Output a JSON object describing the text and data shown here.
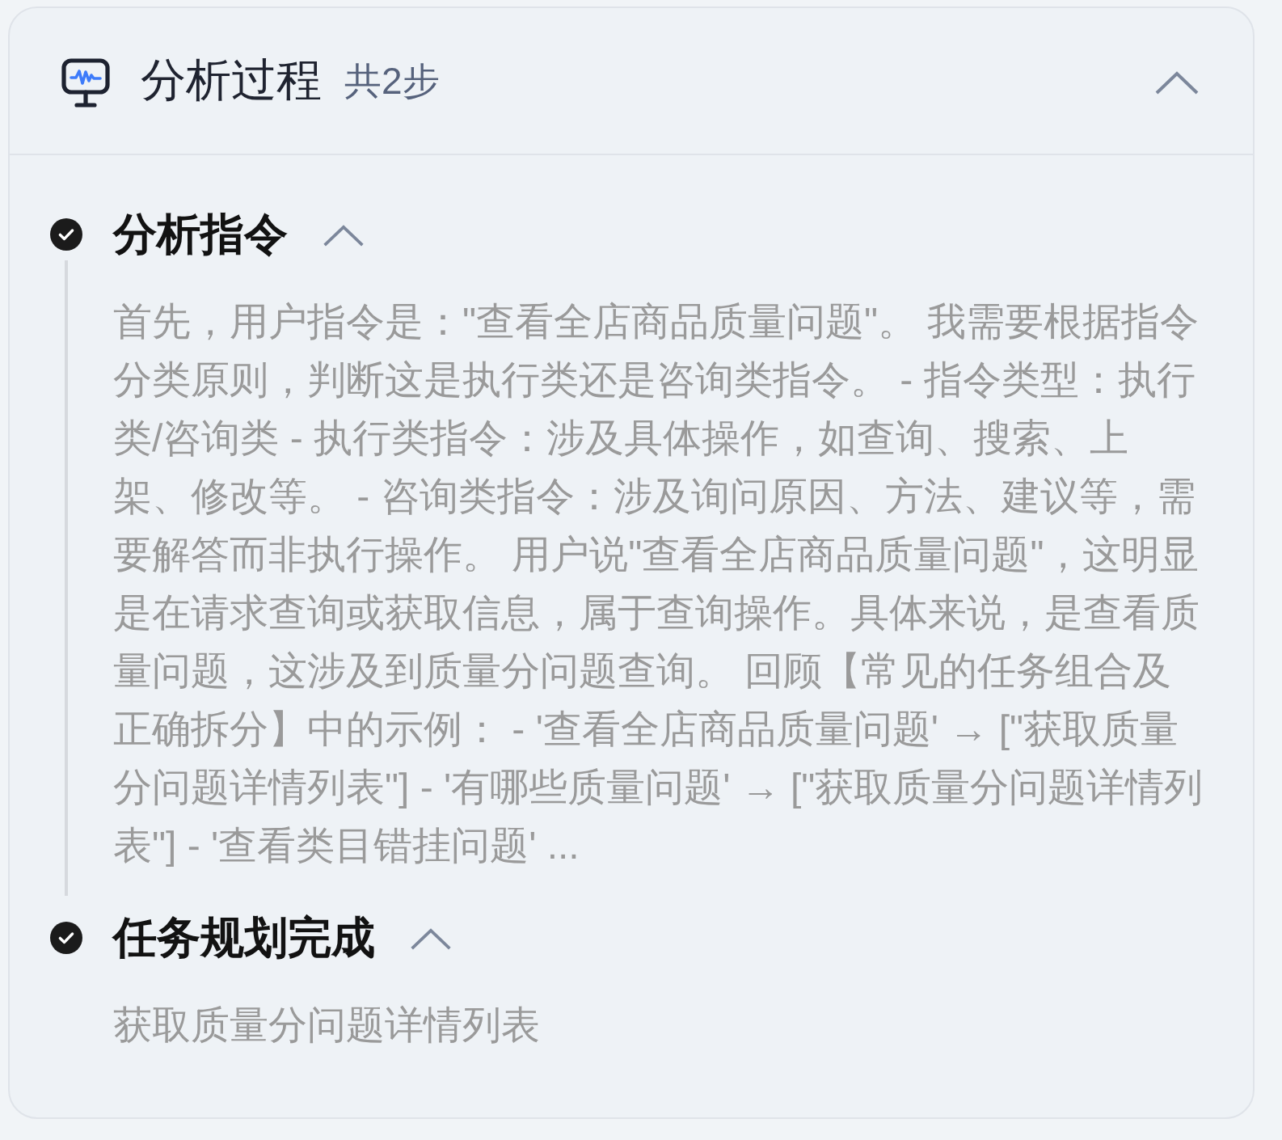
{
  "panel": {
    "title": "分析过程",
    "step_count": "共2步",
    "expanded": true
  },
  "steps": [
    {
      "title": "分析指令",
      "completed": true,
      "expanded": true,
      "text": "首先，用户指令是：\"查看全店商品质量问题\"。 我需要根据指令分类原则，判断这是执行类还是咨询类指令。 - 指令类型：执行类/咨询类 - 执行类指令：涉及具体操作，如查询、搜索、上架、修改等。 - 咨询类指令：涉及询问原因、方法、建议等，需要解答而非执行操作。 用户说\"查看全店商品质量问题\"，这明显是在请求查询或获取信息，属于查询操作。具体来说，是查看质量问题，这涉及到质量分问题查询。 回顾【常见的任务组合及正确拆分】中的示例： - '查看全店商品质量问题' → [\"获取质量分问题详情列表\"] - '有哪些质量问题' → [\"获取质量分问题详情列表\"] - '查看类目错挂问题' ..."
    },
    {
      "title": "任务规划完成",
      "completed": true,
      "expanded": true,
      "text": "获取质量分问题详情列表"
    }
  ]
}
